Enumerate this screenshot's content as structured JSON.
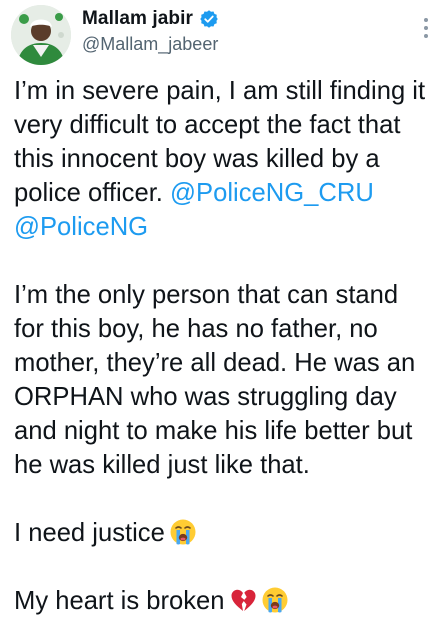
{
  "user": {
    "display_name": "Mallam jabir",
    "handle": "@Mallam_jabeer",
    "verified": true
  },
  "tweet": {
    "p1_text": "I’m in severe pain, I am still finding it very difficult to accept the fact that this innocent boy was killed by a police officer.",
    "p1_mention1": "@PoliceNG_CRU",
    "p1_mention2": "@PoliceNG",
    "p2_text": "I’m the only person that can stand for this boy, he has no father, no mother, they’re all dead. He was an ORPHAN who was struggling day and night to make his life better but he was killed just like that.",
    "p3_text": "I need justice",
    "p3_emoji": "loudly-crying-face-icon",
    "p4_text": "My heart is broken",
    "p4_emojis": [
      "broken-heart-icon",
      "loudly-crying-face-icon"
    ]
  },
  "colors": {
    "text": "#0f1419",
    "secondary_text": "#536471",
    "mention": "#1d9bf0",
    "verified_badge": "#1d9bf0"
  }
}
